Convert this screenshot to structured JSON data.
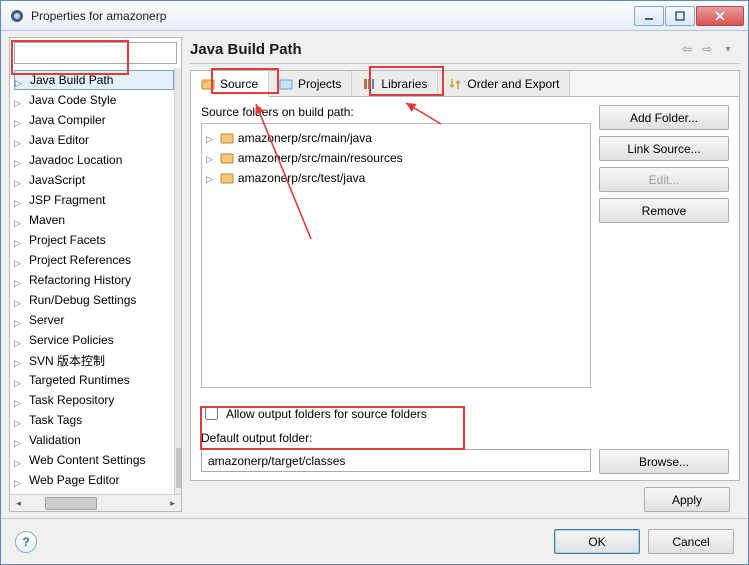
{
  "window_title": "Properties for amazonerp",
  "sidebar_filter": "",
  "sidebar": {
    "items": [
      {
        "label": "Java Build Path",
        "selected": true
      },
      {
        "label": "Java Code Style"
      },
      {
        "label": "Java Compiler"
      },
      {
        "label": "Java Editor"
      },
      {
        "label": "Javadoc Location"
      },
      {
        "label": "JavaScript"
      },
      {
        "label": "JSP Fragment"
      },
      {
        "label": "Maven"
      },
      {
        "label": "Project Facets"
      },
      {
        "label": "Project References"
      },
      {
        "label": "Refactoring History"
      },
      {
        "label": "Run/Debug Settings"
      },
      {
        "label": "Server"
      },
      {
        "label": "Service Policies"
      },
      {
        "label": "SVN 版本控制"
      },
      {
        "label": "Targeted Runtimes"
      },
      {
        "label": "Task Repository"
      },
      {
        "label": "Task Tags"
      },
      {
        "label": "Validation"
      },
      {
        "label": "Web Content Settings"
      },
      {
        "label": "Web Page Editor"
      }
    ]
  },
  "page": {
    "heading": "Java Build Path",
    "tabs": [
      {
        "label": "Source",
        "icon": "package-icon",
        "active": true
      },
      {
        "label": "Projects",
        "icon": "project-icon"
      },
      {
        "label": "Libraries",
        "icon": "library-icon"
      },
      {
        "label": "Order and Export",
        "icon": "order-icon"
      }
    ],
    "source_caption": "Source folders on build path:",
    "source_folders": [
      "amazonerp/src/main/java",
      "amazonerp/src/main/resources",
      "amazonerp/src/test/java"
    ],
    "buttons": {
      "add_folder": "Add Folder...",
      "link_source": "Link Source...",
      "edit": "Edit...",
      "remove": "Remove"
    },
    "allow_output_label": "Allow output folders for source folders",
    "allow_output_checked": false,
    "default_output_label": "Default output folder:",
    "default_output_value": "amazonerp/target/classes",
    "browse": "Browse...",
    "apply": "Apply"
  },
  "dialog": {
    "help_glyph": "?",
    "ok": "OK",
    "cancel": "Cancel"
  }
}
